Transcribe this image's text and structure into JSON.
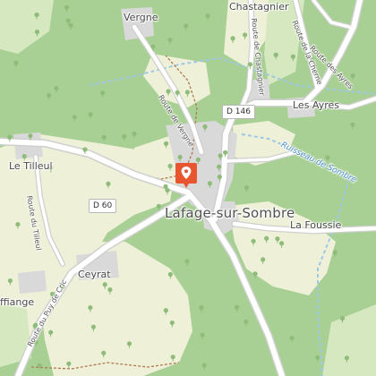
{
  "map": {
    "colors": {
      "forest": "#a9d094",
      "meadow": "#eef1d8",
      "grass": "#d5e8c0",
      "built": "#d9d9d9",
      "road": "#ffffff",
      "road_casing": "#cfcfcf",
      "path": "#b07a50",
      "stream": "#9fc8e6",
      "marker": "#e8562f"
    },
    "labels": {
      "town": "Lafage-sur-Sombre",
      "villages": {
        "vergne": "Vergne",
        "chastagnier": "Chastagnier",
        "les_ayres": "Les Ayres",
        "le_tilleul": "Le Tilleul",
        "ceyrat": "Ceyrat",
        "la_foussie": "La Foussie",
        "affiange": "ffiange"
      },
      "roads": {
        "route_de_vergne": "Route de Vergne",
        "route_de_chastagnier": "Route de Chastagnier",
        "route_de_la_cherne": "Route de la Cherne",
        "route_des_ayres": "Route des Ayres",
        "route_du_tilleul": "Route du Tilleul",
        "route_du_puy_de_cric": "Route du Puy de Cric"
      },
      "shields": {
        "d146": "D 146",
        "d60": "D 60"
      },
      "water": {
        "ruisseau": "Ruisseau de Sombre"
      }
    },
    "marker": {
      "icon": "map-pin-icon"
    }
  }
}
